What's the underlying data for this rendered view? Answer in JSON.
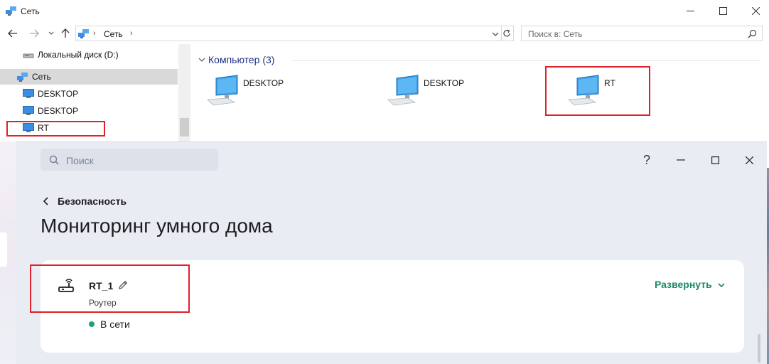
{
  "explorer": {
    "window_title": "Сеть",
    "address_crumb": "Сеть",
    "search_placeholder": "Поиск в: Сеть",
    "nav": {
      "items": [
        {
          "label": "Локальный диск (D:)",
          "icon": "drive-icon"
        },
        {
          "label": "Сеть",
          "icon": "network-icon"
        },
        {
          "label": "DESKTOP",
          "icon": "computer-icon"
        },
        {
          "label": "DESKTOP",
          "icon": "computer-icon"
        },
        {
          "label": "RT",
          "icon": "computer-icon"
        }
      ]
    },
    "group_header": "Компьютер (3)",
    "computers": [
      {
        "name": "DESKTOP"
      },
      {
        "name": "DESKTOP"
      },
      {
        "name": "RT"
      }
    ]
  },
  "app": {
    "search_placeholder": "Поиск",
    "help_label": "?",
    "back_label": "Безопасность",
    "page_title": "Мониторинг умного дома",
    "device": {
      "name": "RT_1",
      "type": "Роутер",
      "status": "В сети",
      "status_color": "#23a07a"
    },
    "expand_label": "Развернуть",
    "accent_color": "#1a8a6a"
  },
  "annotation_color": "#e0202a"
}
